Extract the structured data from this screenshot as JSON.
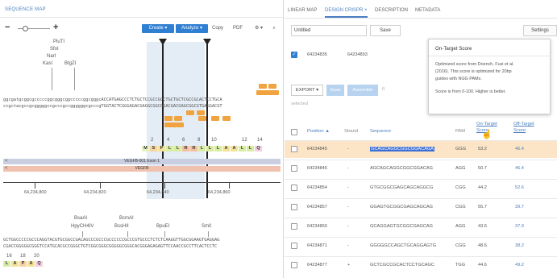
{
  "left": {
    "title": "SEQUENCE MAP",
    "toolbar": {
      "create": "Create",
      "analyze": "Analyze",
      "copy": "Copy",
      "pdf": "PDF",
      "settings_caret": "⚙ ▾",
      "search": "🔍"
    },
    "enzymes_top": [
      "PluTI",
      "SfoI",
      "NarI",
      "KasI",
      "BtgZI"
    ],
    "dna_top": "ggcgatgcggcgcccccggcgggcggcccccggcgggcACCATGAGCCCTCTGCTCCGCCGCCTGCTGCTCGCCGCACTCCTGCA",
    "dna_bottom": "ccgctacgccgcgggggccgcccgccggggggcgcccgTGGTACTCGGGAGACGAGGCGGCGGACGACGAGCGGCGTGAGGACGT",
    "number_row": [
      "2",
      "4",
      "6",
      "8",
      "10",
      "12",
      "14"
    ],
    "aa_row": [
      "M",
      "S",
      "P",
      "L",
      "L",
      "R",
      "R",
      "L",
      "L",
      "L",
      "A",
      "A",
      "L",
      "L",
      "Q"
    ],
    "track1": "VEGFB-001 Exon 1",
    "track2": "VEGFB",
    "ruler": [
      "64,234,800",
      "64,234,820",
      "64,234,840",
      "64,234,860"
    ],
    "enzymes_bottom": [
      {
        "name": "BsaAI",
        "row": 1
      },
      {
        "name": "BcmAI",
        "row": 1
      },
      {
        "name": "HpyCH4IV",
        "row": 2
      },
      {
        "name": "BssHII",
        "row": 2
      },
      {
        "name": "BpuEI",
        "row": 2
      },
      {
        "name": "SmlI",
        "row": 2
      }
    ],
    "dna2_top": "GCTGGCCCCCGCCCAGGTACGTGCGGCCGACAGCCCGCCCGCCCCCCGCCCGTGCCCTCTCTCAAGGTTGGCGGAAGTGAGGAG",
    "dna2_bottom": "CGACCGGGGGCGGGTCCATGCACGCCGGGCTGTCGGCGGGCGGGGGCGGGCACGGGAGAGAGTTCCAACCGCCTTCACTCCTC",
    "number_row2": [
      "16",
      "18",
      "20"
    ],
    "aa_row2": [
      "L",
      "A",
      "P",
      "A",
      "Q"
    ]
  },
  "right": {
    "tabs": [
      "LINEAR MAP",
      "DESIGN CRISPR",
      "DESCRIPTION",
      "METADATA"
    ],
    "tab_close": "×",
    "title_input": "Untitled",
    "save_label": "Save",
    "settings_label": "Settings",
    "guide_row": {
      "pos": "64234835",
      "pos2": "64234893"
    },
    "export_label": "EXPORT ▾",
    "save2_label": "Save",
    "assemble_label": "Assemble",
    "assemble_count": "0",
    "selected_label": "selected",
    "headers": [
      "Position ▲",
      "Strand",
      "Sequence",
      "PAM",
      "On-Target Score",
      "Off-Target Score"
    ],
    "rows": [
      {
        "position": "64234845",
        "strand": "-",
        "sequence": "GCAGCAGGCGGCGGACAGA",
        "pam": "GGG",
        "on": "53.2",
        "off": "46.4",
        "highlight": true
      },
      {
        "position": "64234846",
        "strand": "-",
        "sequence": "AGCAGCAGGCGGCGGACAG",
        "pam": "AGG",
        "on": "50.7",
        "off": "46.4",
        "highlight": false
      },
      {
        "position": "64234854",
        "strand": "-",
        "sequence": "GTGCGGCGAGCAGCAGGCG",
        "pam": "CGG",
        "on": "44.2",
        "off": "52.6",
        "highlight": false
      },
      {
        "position": "64234857",
        "strand": "-",
        "sequence": "GGAGTGCGGCGAGCAGCAG",
        "pam": "CGG",
        "on": "55.7",
        "off": "39.7",
        "highlight": false
      },
      {
        "position": "64234860",
        "strand": "-",
        "sequence": "GCAGGAGTGCGGCGAGCAG",
        "pam": "AGG",
        "on": "43.6",
        "off": "37.9",
        "highlight": false
      },
      {
        "position": "64234871",
        "strand": "-",
        "sequence": "GGGGGCCAGCTGCAGGAGTG",
        "pam": "CGG",
        "on": "48.6",
        "off": "38.2",
        "highlight": false
      },
      {
        "position": "64234877",
        "strand": "+",
        "sequence": "GCTCGCCGCACTCCTGCAGC",
        "pam": "TGG",
        "on": "44.6",
        "off": "49.2",
        "highlight": false
      }
    ],
    "tooltip": {
      "title": "On-Target Score",
      "lines": [
        "Optimized score from Doench, Fusi et al.",
        "(2016). This score is optimized for 20bp",
        "guides with NGG PAMs."
      ],
      "footer": "Score is from 0-100. Higher is better."
    }
  },
  "colors": {
    "accent": "#2f7fd3",
    "highlight_row": "#fce4c6",
    "seq_select": "#3b6fd6",
    "orange": "#f0a33e"
  }
}
